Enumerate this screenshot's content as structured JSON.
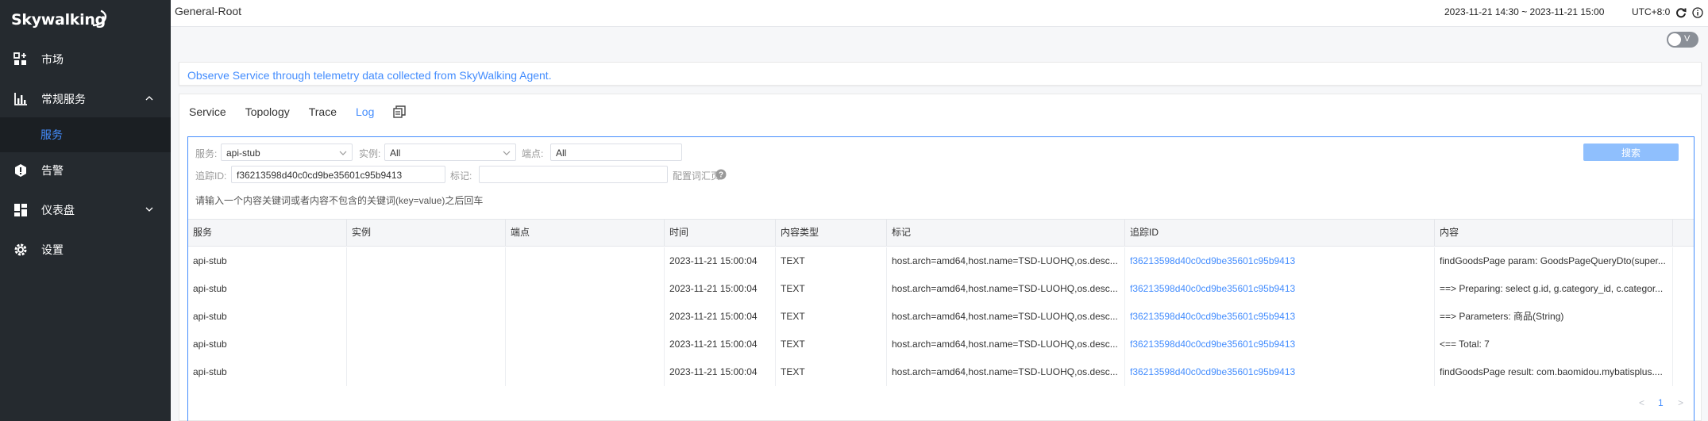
{
  "sidebar": {
    "logo": "Skywalking",
    "items": [
      {
        "label": "市场",
        "icon": "marketplace-icon"
      },
      {
        "label": "常规服务",
        "icon": "bar-chart-icon"
      },
      {
        "label": "服务",
        "icon": ""
      },
      {
        "label": "告警",
        "icon": "alert-icon"
      },
      {
        "label": "仪表盘",
        "icon": "dashboard-icon"
      },
      {
        "label": "设置",
        "icon": "gear-icon"
      }
    ]
  },
  "header": {
    "breadcrumb": "General-Root",
    "time_range": "2023-11-21 14:30 ~ 2023-11-21 15:00",
    "timezone": "UTC+8:0",
    "toggle_label": "V"
  },
  "banner": "Observe Service through telemetry data collected from SkyWalking Agent.",
  "tabs": [
    "Service",
    "Topology",
    "Trace",
    "Log"
  ],
  "active_tab": "Log",
  "filters": {
    "service_label": "服务:",
    "service_value": "api-stub",
    "instance_label": "实例:",
    "instance_value": "All",
    "endpoint_label": "端点:",
    "endpoint_value": "All",
    "trace_id_label": "追踪ID:",
    "trace_id_value": "f36213598d40c0cd9be35601c95b9413",
    "tags_label": "标记:",
    "tags_value": "",
    "config_label": "配置词汇页",
    "hint": "请输入一个内容关键词或者内容不包含的关键词(key=value)之后回车",
    "search_button": "搜索"
  },
  "table": {
    "columns": [
      "服务",
      "实例",
      "端点",
      "时间",
      "内容类型",
      "标记",
      "追踪ID",
      "内容"
    ],
    "rows": [
      [
        "api-stub",
        "",
        "",
        "2023-11-21 15:00:04",
        "TEXT",
        "host.arch=amd64,host.name=TSD-LUOHQ,os.desc...",
        "f36213598d40c0cd9be35601c95b9413",
        "findGoodsPage param: GoodsPageQueryDto(super..."
      ],
      [
        "api-stub",
        "",
        "",
        "2023-11-21 15:00:04",
        "TEXT",
        "host.arch=amd64,host.name=TSD-LUOHQ,os.desc...",
        "f36213598d40c0cd9be35601c95b9413",
        "==> Preparing: select g.id, g.category_id, c.categor..."
      ],
      [
        "api-stub",
        "",
        "",
        "2023-11-21 15:00:04",
        "TEXT",
        "host.arch=amd64,host.name=TSD-LUOHQ,os.desc...",
        "f36213598d40c0cd9be35601c95b9413",
        "==> Parameters: 商品(String)"
      ],
      [
        "api-stub",
        "",
        "",
        "2023-11-21 15:00:04",
        "TEXT",
        "host.arch=amd64,host.name=TSD-LUOHQ,os.desc...",
        "f36213598d40c0cd9be35601c95b9413",
        "<== Total: 7"
      ],
      [
        "api-stub",
        "",
        "",
        "2023-11-21 15:00:04",
        "TEXT",
        "host.arch=amd64,host.name=TSD-LUOHQ,os.desc...",
        "f36213598d40c0cd9be35601c95b9413",
        "findGoodsPage result: com.baomidou.mybatisplus...."
      ]
    ]
  },
  "pagination": {
    "prev": "<",
    "current": "1",
    "next": ">"
  },
  "colors": {
    "accent": "#448dfe",
    "sidebar_bg": "#252a2f"
  }
}
